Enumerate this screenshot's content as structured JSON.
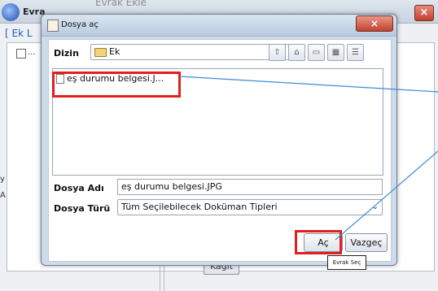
{
  "background_window": {
    "title": "Evra",
    "ghost_title": "Evrak Ekle",
    "tab_label": "[ Ek L",
    "list_item_label": "...",
    "left_text_a": "y",
    "left_text_b": "A",
    "kagit_button": "Kağıt"
  },
  "dialog": {
    "title": "Dosya aç",
    "close_icon": "close-icon",
    "dizin_label": "Dizin",
    "dizin_value": "Ek",
    "toolbar_icons": [
      "up-folder-icon",
      "home-icon",
      "new-folder-icon",
      "list-view-icon",
      "details-view-icon"
    ],
    "files": [
      {
        "name": "eş durumu belgesi.J..."
      }
    ],
    "dosya_adi_label": "Dosya Adı",
    "dosya_adi_value": "eş durumu belgesi.JPG",
    "dosya_turu_label": "Dosya Türü",
    "dosya_turu_value": "Tüm Seçilebilecek Doküman Tipleri",
    "open_button": "Aç",
    "cancel_button": "Vazgeç"
  },
  "tooltip": "Evrak Seç",
  "colors": {
    "highlight_red": "#e0201a",
    "arrow_blue": "#3f8bd6"
  }
}
